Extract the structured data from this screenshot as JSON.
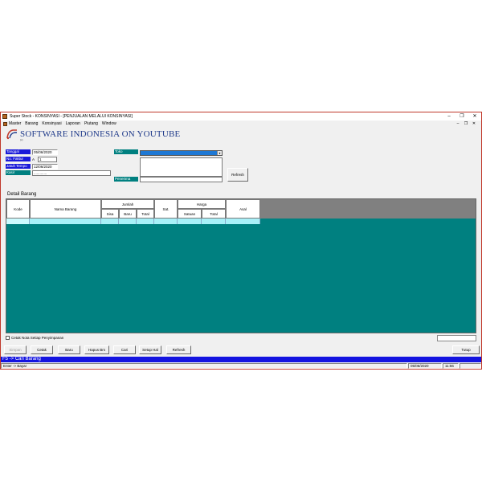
{
  "window": {
    "title": "Super Stock - KONSINYASI - [PENJUALAN MELALUI KONSINYASI]",
    "controls": [
      "–",
      "❐",
      "✕"
    ]
  },
  "menu": {
    "items": [
      "Master",
      "Barang",
      "Konsinyasi",
      "Laporan",
      "Piutang",
      "Window"
    ],
    "mdi_controls": [
      "–",
      "❐",
      "✕"
    ]
  },
  "banner": {
    "title": "SOFTWARE INDONESIA ON YOUTUBE",
    "subtitle": "(c)"
  },
  "form": {
    "tanggal_label": "Tanggal",
    "tanggal_value": "05/06/2020",
    "nofaktur_label": "No. Faktur",
    "nofaktur_prefix": "A",
    "nofaktur_value": "1",
    "jatuh_tempo_label": "Jatuh Tempo",
    "jatuh_tempo_value": "12/06/2020",
    "kasir_label": "Kasir",
    "kasir_value": ".............",
    "toko_label": "Toko",
    "penerima_label": "Penerima",
    "refresh_label": "Refresh"
  },
  "detail": {
    "section_label": "Detail Barang",
    "headers": {
      "kode": "Kode",
      "nama_barang": "Nama Barang",
      "jumlah": "Jumlah",
      "sisa": "Sisa",
      "baru": "Baru",
      "total": "Total",
      "sat": "Sat.",
      "harga": "Harga",
      "satuan": "Satuan",
      "harga_total": "Total",
      "asal": "Asal"
    }
  },
  "footer": {
    "cetak_nota_label": "Cetak Nota Setiap Penyimpanan",
    "buttons": {
      "simpan": "Simpan",
      "cetak": "Cetak",
      "baru": "Baru",
      "hapus_brs": "Hapus Brs",
      "cari": "Cari",
      "setup_hal": "Setup Hal",
      "refresh": "Refresh",
      "tutup": "Tutup"
    },
    "hint": "F5 -> Cari Barang",
    "status_left": "Enter -> Bayar",
    "status_date": "05/06/2020",
    "status_time": "11:56"
  },
  "colors": {
    "label_blue": "#1a1ad9",
    "label_teal": "#008080",
    "grid_bg": "#008080",
    "banner_blue": "#1f3a8a",
    "hint_bar": "#1414e0"
  }
}
